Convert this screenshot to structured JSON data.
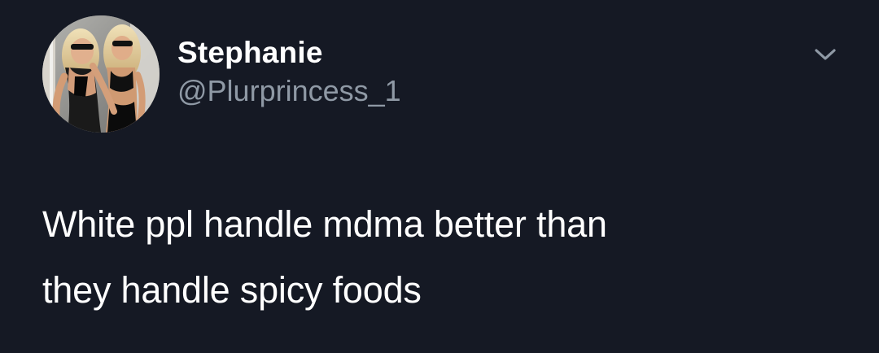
{
  "tweet": {
    "author": {
      "display_name": "Stephanie",
      "handle": "@Plurprincess_1"
    },
    "text_lines": [
      "White ppl handle mdma better than",
      "they handle spicy foods"
    ],
    "menu_icon": "chevron-down-icon"
  },
  "colors": {
    "background": "#151924",
    "primary_text": "#ffffff",
    "secondary_text": "#8f99a5",
    "icon": "#8f99a5"
  }
}
